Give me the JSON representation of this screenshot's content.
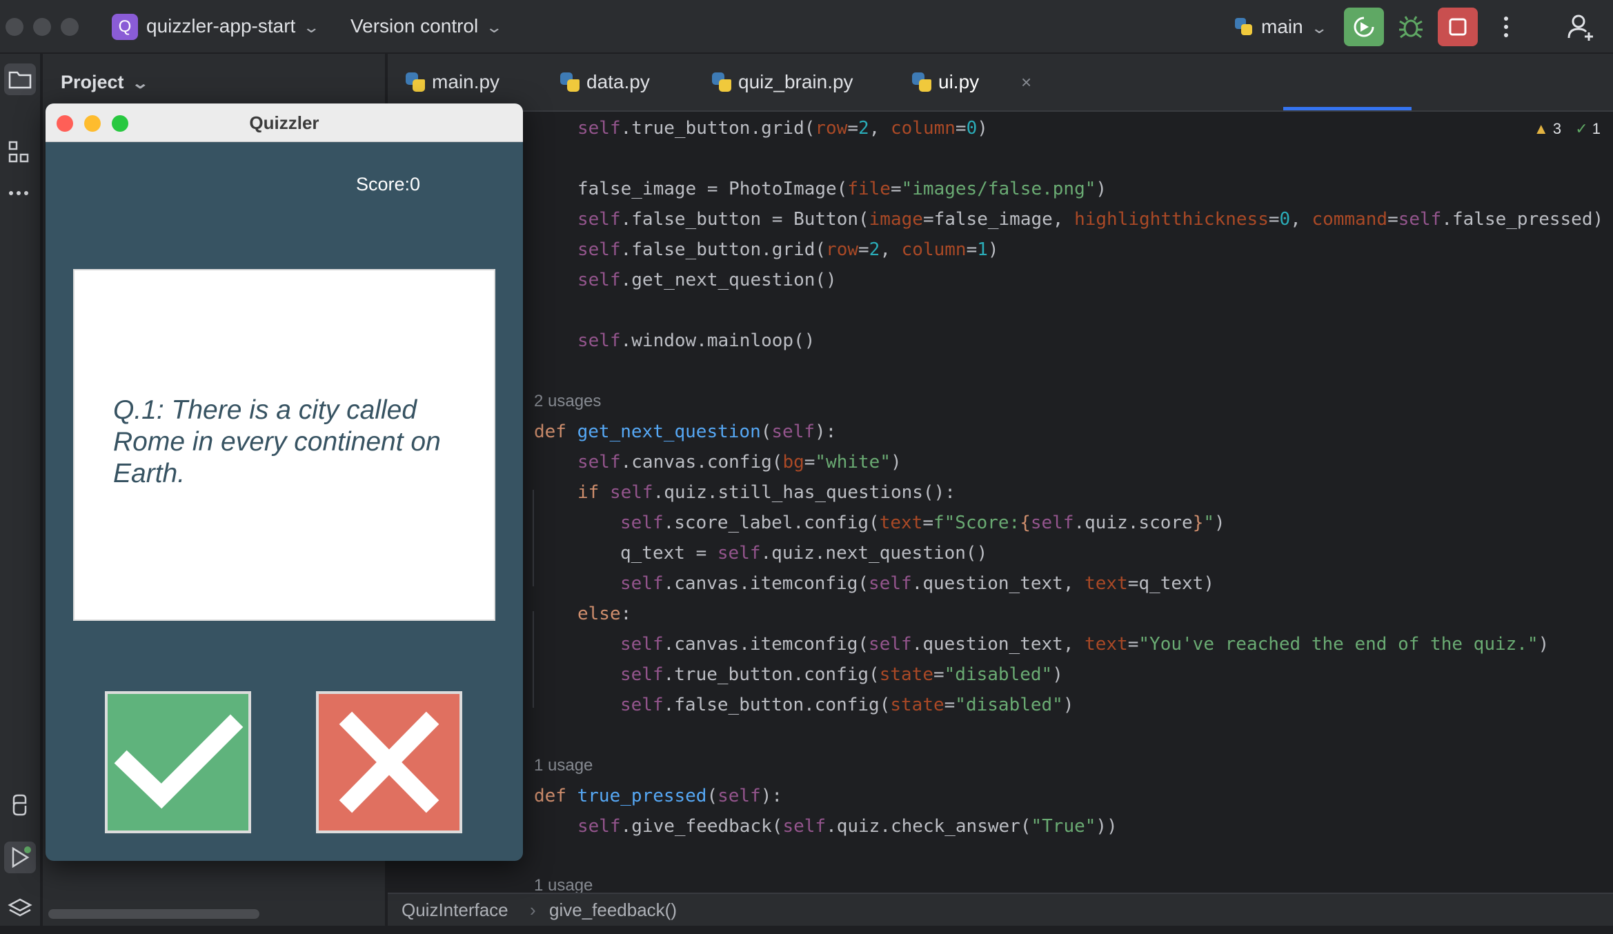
{
  "titlebar": {
    "project_badge": "Q",
    "project_name": "quizzler-app-start",
    "version_control": "Version control",
    "branch": "main",
    "icons": [
      "run-coverage-icon",
      "debug-icon",
      "stop-icon",
      "more-icon",
      "add-user-icon"
    ]
  },
  "project_panel": {
    "title": "Project"
  },
  "tabs": [
    {
      "label": "main.py",
      "active": false
    },
    {
      "label": "data.py",
      "active": false
    },
    {
      "label": "quiz_brain.py",
      "active": false
    },
    {
      "label": "ui.py",
      "active": true
    }
  ],
  "editor": {
    "warnings": "3",
    "checks": "1",
    "inlays": [
      "2 usages",
      "1 usage",
      "1 usage"
    ]
  },
  "statusbar": {
    "crumb1": "QuizInterface",
    "crumb2": "give_feedback()"
  },
  "quizzler": {
    "title": "Quizzler",
    "score": "Score:0",
    "question": "Q.1: There is a city called Rome in every continent on Earth.",
    "colors": {
      "background": "#375362",
      "true": "#5fb37c",
      "false": "#e07060"
    }
  }
}
